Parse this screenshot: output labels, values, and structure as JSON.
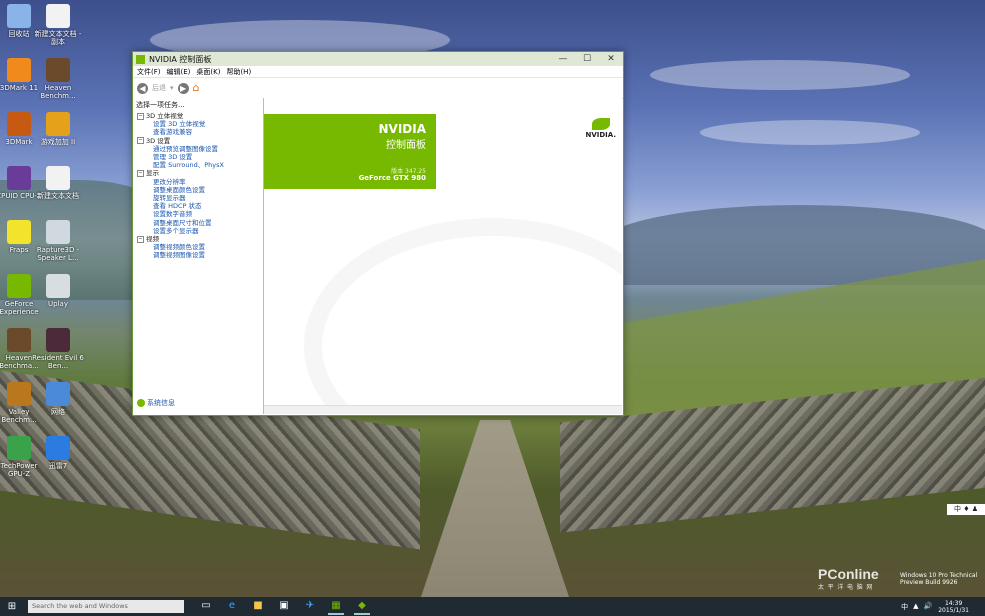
{
  "desktop": {
    "icons": [
      {
        "label": "回收站",
        "color": "#8ab4e8"
      },
      {
        "label": "新建文本文档 - 副本",
        "color": "#f2f2f2"
      },
      {
        "label": "3DMark 11",
        "color": "#f08a1c"
      },
      {
        "label": "Heaven Benchm...",
        "color": "#6b4a2b"
      },
      {
        "label": "3DMark",
        "color": "#c75a12"
      },
      {
        "label": "游戏加加 II",
        "color": "#e6a11a"
      },
      {
        "label": "CPUID CPU-Z",
        "color": "#6a3c9a"
      },
      {
        "label": "新建文本文档",
        "color": "#f2f2f2"
      },
      {
        "label": "Fraps",
        "color": "#f2e32b"
      },
      {
        "label": "Rapture3D - Speaker L...",
        "color": "#d0d8e0"
      },
      {
        "label": "GeForce Experience",
        "color": "#76b900"
      },
      {
        "label": "Uplay",
        "color": "#d8dde2"
      },
      {
        "label": "Heaven Benchma...",
        "color": "#6b4a2b"
      },
      {
        "label": "Resident Evil 6 Ben...",
        "color": "#4c2a3a"
      },
      {
        "label": "Valley Benchm...",
        "color": "#b9771e"
      },
      {
        "label": "网络",
        "color": "#4a8ad8"
      },
      {
        "label": "TechPower GPU-Z",
        "color": "#3aa24a"
      },
      {
        "label": "迅雷7",
        "color": "#2a7ce0"
      }
    ]
  },
  "window": {
    "title": "NVIDIA 控制面板",
    "controls": {
      "minimize": "—",
      "maximize": "☐",
      "close": "✕"
    },
    "menu": [
      "文件(F)",
      "编辑(E)",
      "桌面(K)",
      "帮助(H)"
    ],
    "toolbar": {
      "back_label": "后退",
      "back_arrow": "◀",
      "forward_arrow": "▶",
      "dropdown": "▾",
      "home_icon": "⌂"
    },
    "task_header": "选择一项任务...",
    "tree": [
      {
        "category": "3D 立体视觉",
        "items": [
          "设置 3D 立体视觉",
          "查看游戏兼容"
        ]
      },
      {
        "category": "3D 设置",
        "items": [
          "通过预览调整图像设置",
          "管理 3D 设置",
          "配置 Surround、PhysX"
        ]
      },
      {
        "category": "显示",
        "items": [
          "更改分辨率",
          "调整桌面颜色设置",
          "旋转显示器",
          "查看 HDCP 状态",
          "设置数字音频",
          "调整桌面尺寸和位置",
          "设置多个显示器"
        ]
      },
      {
        "category": "视频",
        "items": [
          "调整视频颜色设置",
          "调整视频图像设置"
        ]
      }
    ],
    "help_link": "系统信息",
    "banner": {
      "brand": "NVIDIA",
      "product": "控制面板",
      "version": "版本 347.25",
      "gpu": "GeForce GTX 980"
    },
    "logo_text": "NVIDIA."
  },
  "taskbar": {
    "start_icon": "⊞",
    "search_placeholder": "Search the web and Windows",
    "time": "14:39",
    "date": "2015/1/31",
    "tray": [
      "中",
      "▲",
      "🔊"
    ]
  },
  "ime_indicator": "中 ♦ ♟",
  "watermark": {
    "brand": "PConline",
    "sub": "太 平 洋 电 脑 网"
  },
  "build_text": "Windows 10 Pro Technical Preview Build 9926"
}
